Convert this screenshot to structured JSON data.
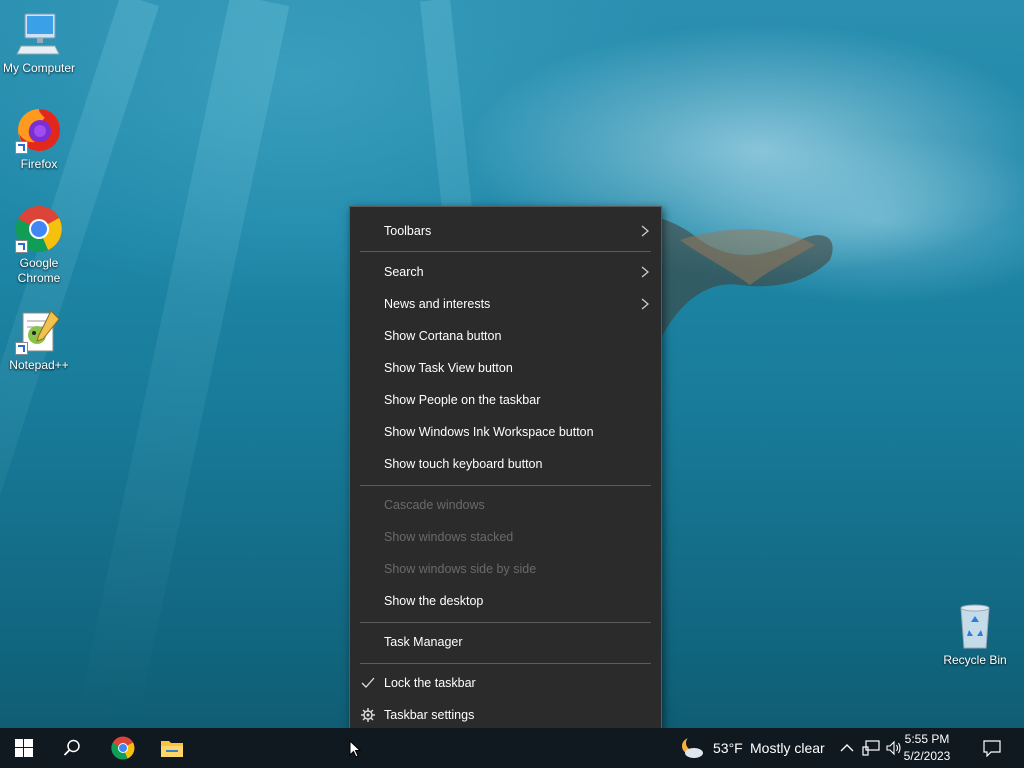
{
  "desktop": {
    "icons": [
      {
        "label": "My Computer"
      },
      {
        "label": "Firefox"
      },
      {
        "label": "Google Chrome"
      },
      {
        "label": "Notepad++"
      },
      {
        "label": "Recycle Bin"
      }
    ]
  },
  "context_menu": {
    "toolbars": "Toolbars",
    "search": "Search",
    "news": "News and interests",
    "cortana": "Show Cortana button",
    "task_view": "Show Task View button",
    "people": "Show People on the taskbar",
    "ink": "Show Windows Ink Workspace button",
    "touch_keyboard": "Show touch keyboard button",
    "cascade": "Cascade windows",
    "stacked": "Show windows stacked",
    "side_by_side": "Show windows side by side",
    "show_desktop": "Show the desktop",
    "task_manager": "Task Manager",
    "lock_taskbar": "Lock the taskbar",
    "taskbar_settings": "Taskbar settings"
  },
  "taskbar": {
    "weather_temp": "53°F",
    "weather_text": "Mostly clear",
    "time": "5:55 PM",
    "date": "5/2/2023"
  },
  "colors": {
    "menu_bg": "#2b2b2b",
    "taskbar_bg": "#101820",
    "disabled_text": "#6a6a6a"
  }
}
